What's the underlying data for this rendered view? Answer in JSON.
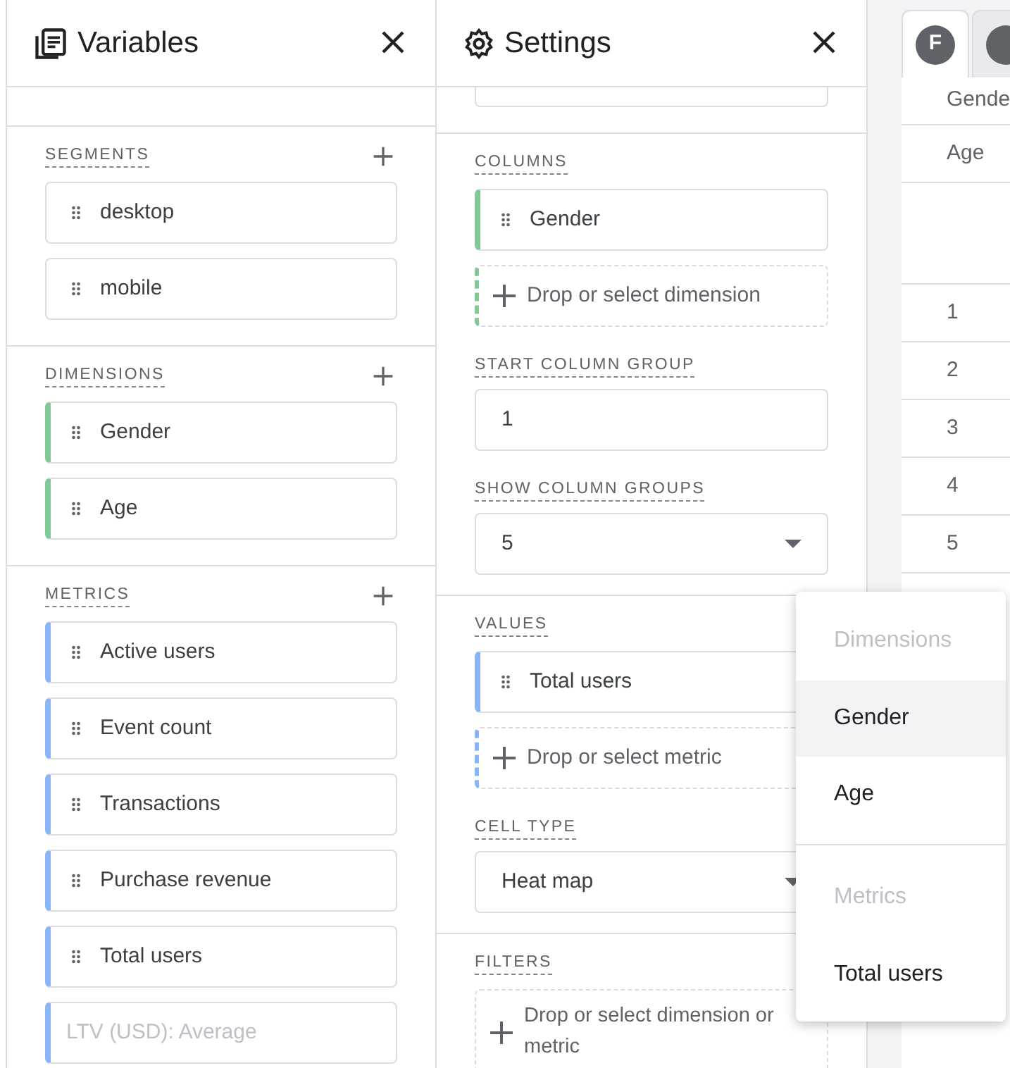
{
  "variables_panel": {
    "title": "Variables",
    "sections": [
      {
        "label": "SEGMENTS",
        "kind": "segment",
        "items": [
          {
            "label": "desktop",
            "disabled": false
          },
          {
            "label": "mobile",
            "disabled": false
          }
        ]
      },
      {
        "label": "DIMENSIONS",
        "kind": "dimension",
        "items": [
          {
            "label": "Gender",
            "disabled": false
          },
          {
            "label": "Age",
            "disabled": false
          }
        ]
      },
      {
        "label": "METRICS",
        "kind": "metric",
        "items": [
          {
            "label": "Active users",
            "disabled": false
          },
          {
            "label": "Event count",
            "disabled": false
          },
          {
            "label": "Transactions",
            "disabled": false
          },
          {
            "label": "Purchase revenue",
            "disabled": false
          },
          {
            "label": "Total users",
            "disabled": false
          },
          {
            "label": "LTV (USD): Average",
            "disabled": true
          }
        ]
      }
    ]
  },
  "settings_panel": {
    "title": "Settings",
    "sections": [
      {
        "fields": [
          {
            "kind": "dimension_list",
            "label": "COLUMNS",
            "items": [
              {
                "label": "Gender"
              }
            ],
            "drop": "Drop or select dimension"
          },
          {
            "kind": "input",
            "label": "START COLUMN GROUP",
            "value": "1"
          },
          {
            "kind": "select",
            "label": "SHOW COLUMN GROUPS",
            "value": "5"
          }
        ]
      },
      {
        "fields": [
          {
            "kind": "metric_list",
            "label": "VALUES",
            "items": [
              {
                "label": "Total users"
              }
            ],
            "drop": "Drop or select metric"
          },
          {
            "kind": "select",
            "label": "CELL TYPE",
            "value": "Heat map"
          }
        ]
      },
      {
        "fields": [
          {
            "kind": "filter_list",
            "label": "FILTERS",
            "drop": "Drop or select dimension or metric"
          }
        ]
      }
    ]
  },
  "table": {
    "tabs": [
      {
        "avatar": "F",
        "selected": true
      },
      {
        "selected": false
      }
    ],
    "header_rows": [
      "Gende",
      "Age"
    ],
    "rows": [
      "1",
      "2",
      "3",
      "4",
      "5"
    ]
  },
  "dropdown_menu": {
    "groups": [
      {
        "header": "Dimensions",
        "options": [
          {
            "label": "Gender",
            "selected": true
          },
          {
            "label": "Age",
            "selected": false
          }
        ]
      },
      {
        "header": "Metrics",
        "options": [
          {
            "label": "Total users",
            "selected": false
          }
        ]
      }
    ]
  }
}
